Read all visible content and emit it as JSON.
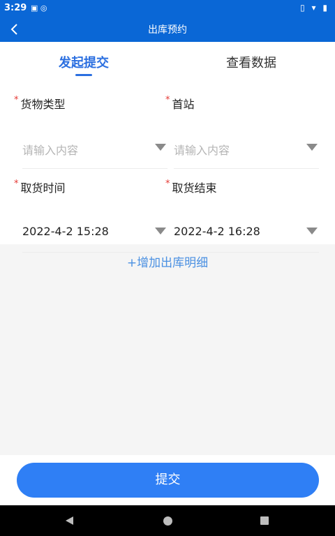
{
  "status_bar": {
    "time": "3:29",
    "left_icons": "▣ ◎",
    "right_icons": "▯ ▾ ▮"
  },
  "app_bar": {
    "title": "出库预约",
    "back_icon": "chevron-left-icon"
  },
  "tabs": [
    {
      "label": "发起提交",
      "active": true
    },
    {
      "label": "查看数据",
      "active": false
    }
  ],
  "form": {
    "fields": [
      {
        "label": "货物类型",
        "required_mark": "*",
        "value": "",
        "placeholder": "请输入内容"
      },
      {
        "label": "首站",
        "required_mark": "*",
        "value": "",
        "placeholder": "请输入内容"
      },
      {
        "label": "取货时间",
        "required_mark": "*",
        "value": "2022-4-2 15:28",
        "placeholder": ""
      },
      {
        "label": "取货结束",
        "required_mark": "*",
        "value": "2022-4-2 16:28",
        "placeholder": ""
      }
    ]
  },
  "add_detail_label": "+增加出库明细",
  "submit_label": "提交",
  "colors": {
    "primary": "#0a67d6",
    "accent": "#2f7ff5",
    "link": "#4a90e2",
    "required": "#e53935"
  }
}
